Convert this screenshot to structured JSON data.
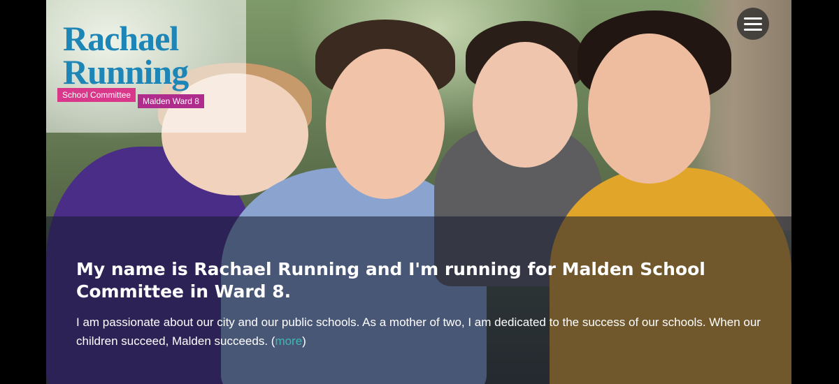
{
  "logo": {
    "line1": "Rachael",
    "line2": "Running",
    "tag_committee": "School Committee",
    "tag_ward": "Malden Ward 8"
  },
  "menu": {
    "icon": "hamburger-menu-icon"
  },
  "hero": {
    "headline": "My name is Rachael Running and I'm running for Malden School Committee in Ward 8.",
    "body_prefix": "I am passionate about our city and our public schools. As a mother of two, I am dedicated to the success of our schools. When our children succeed, Malden succeeds. (",
    "more_label": "more",
    "body_suffix": ")"
  },
  "colors": {
    "brand_blue": "#1d86b6",
    "brand_pink": "#d9388a",
    "brand_magenta": "#b02c8c",
    "link_teal": "#3fb8b0"
  }
}
